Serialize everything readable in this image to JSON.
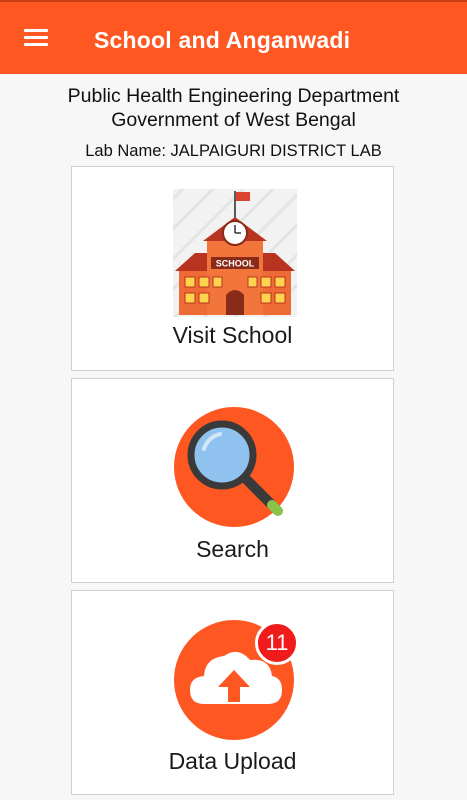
{
  "app_bar": {
    "title": "School and Anganwadi",
    "menu_icon": "hamburger-menu-icon",
    "color": "#fe5722"
  },
  "header": {
    "department": "Public Health Engineering Department",
    "government": "Government of West Bengal",
    "lab_name": "Lab Name: JALPAIGURI DISTRICT LAB"
  },
  "cards": [
    {
      "label": "Visit School",
      "icon": "school-building-icon",
      "sign_text": "SCHOOL"
    },
    {
      "label": "Search",
      "icon": "magnifier-search-icon"
    },
    {
      "label": "Data Upload",
      "icon": "cloud-upload-icon",
      "badge": "11"
    }
  ]
}
